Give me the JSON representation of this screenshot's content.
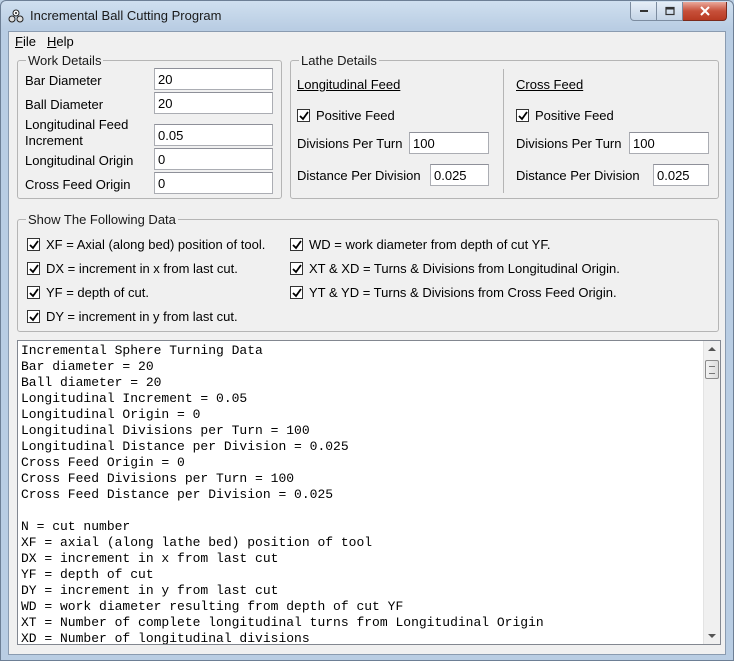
{
  "window": {
    "title": "Incremental Ball Cutting Program"
  },
  "menu": {
    "file": "File",
    "help": "Help"
  },
  "work_details": {
    "legend": "Work Details",
    "bar_diameter_label": "Bar Diameter",
    "bar_diameter_value": "20",
    "ball_diameter_label": "Ball Diameter",
    "ball_diameter_value": "20",
    "long_feed_increment_label_1": "Longitudinal Feed",
    "long_feed_increment_label_2": "Increment",
    "long_feed_increment_value": "0.05",
    "long_origin_label": "Longitudinal Origin",
    "long_origin_value": "0",
    "cross_feed_origin_label": "Cross Feed Origin",
    "cross_feed_origin_value": "0"
  },
  "lathe_details": {
    "legend": "Lathe Details",
    "longitudinal": {
      "heading": "Longitudinal Feed",
      "positive_feed_label": "Positive Feed",
      "positive_feed_checked": true,
      "divisions_label": "Divisions Per Turn",
      "divisions_value": "100",
      "distance_label": "Distance Per Division",
      "distance_value": "0.025"
    },
    "cross": {
      "heading": "Cross Feed",
      "positive_feed_label": "Positive Feed",
      "positive_feed_checked": true,
      "divisions_label": "Divisions Per Turn",
      "divisions_value": "100",
      "distance_label": "Distance Per Division",
      "distance_value": "0.025"
    }
  },
  "show_data": {
    "legend": "Show The Following Data",
    "options": [
      {
        "label": "XF = Axial (along bed) position of tool.",
        "checked": true
      },
      {
        "label": "DX = increment in x from last cut.",
        "checked": true
      },
      {
        "label": "YF = depth of cut.",
        "checked": true
      },
      {
        "label": "DY = increment in y from last cut.",
        "checked": true
      },
      {
        "label": "WD = work diameter from depth of cut YF.",
        "checked": true
      },
      {
        "label": "XT & XD = Turns & Divisions from Longitudinal Origin.",
        "checked": true
      },
      {
        "label": "YT & YD = Turns & Divisions from Cross Feed Origin.",
        "checked": true
      }
    ]
  },
  "output": {
    "lines": [
      "Incremental Sphere Turning Data",
      "Bar diameter = 20",
      "Ball diameter = 20",
      "Longitudinal Increment = 0.05",
      "Longitudinal Origin = 0",
      "Longitudinal Divisions per Turn = 100",
      "Longitudinal Distance per Division = 0.025",
      "Cross Feed Origin = 0",
      "Cross Feed Divisions per Turn = 100",
      "Cross Feed Distance per Division = 0.025",
      "",
      "N = cut number",
      "XF = axial (along lathe bed) position of tool",
      "DX = increment in x from last cut",
      "YF = depth of cut",
      "DY = increment in y from last cut",
      "WD = work diameter resulting from depth of cut YF",
      "XT = Number of complete longitudinal turns from Longitudinal Origin",
      "XD = Number of longitudinal divisions"
    ]
  },
  "colors": {
    "close_button": "#c7503a",
    "title_bar": "#b9cde3"
  }
}
